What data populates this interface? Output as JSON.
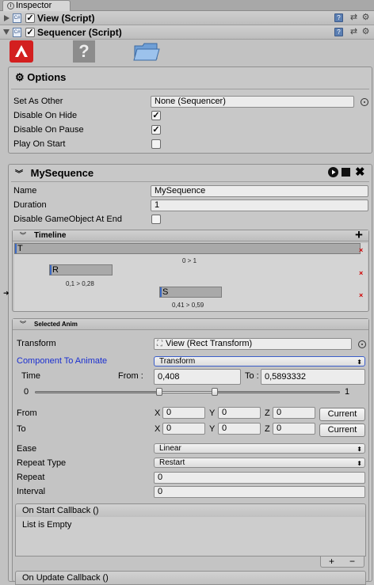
{
  "tab": {
    "title": "Inspector"
  },
  "view_component": {
    "title": "View (Script)",
    "enabled_mark": "✓"
  },
  "sequencer_component": {
    "title": "Sequencer (Script)",
    "enabled_mark": "✓"
  },
  "options": {
    "title": "Options",
    "set_as_other": {
      "label": "Set As Other",
      "value": "None (Sequencer)"
    },
    "disable_on_hide": {
      "label": "Disable On Hide",
      "checked": true,
      "mark": "✓"
    },
    "disable_on_pause": {
      "label": "Disable On Pause",
      "checked": true,
      "mark": "✓"
    },
    "play_on_start": {
      "label": "Play On Start",
      "checked": false,
      "mark": ""
    }
  },
  "sequence": {
    "title": "MySequence",
    "name": {
      "label": "Name",
      "value": "MySequence"
    },
    "duration": {
      "label": "Duration",
      "value": "1"
    },
    "disable_go": {
      "label": "Disable GameObject At End",
      "mark": ""
    }
  },
  "timeline": {
    "title": "Timeline",
    "add": "+",
    "tracks": [
      {
        "label": "T",
        "range": "0 > 1"
      },
      {
        "label": "R",
        "range": "0,1 > 0,28"
      },
      {
        "label": "S",
        "range": "0,41 > 0,59"
      }
    ],
    "delete": "×",
    "pointer": "➜"
  },
  "selected": {
    "title": "Selected Anim",
    "transform": {
      "label": "Transform",
      "value": "View (Rect Transform)"
    },
    "component": {
      "label": "Component To Animate",
      "value": "Transform"
    },
    "time": {
      "label": "Time",
      "from_label": "From :",
      "from": "0,408",
      "to_label": "To :",
      "to": "0,5893332"
    },
    "slider": {
      "min": "0",
      "max": "1",
      "from": 0.408,
      "to": 0.5893332
    },
    "from_row": {
      "label": "From",
      "x": "0",
      "y": "0",
      "z": "0",
      "button": "Current"
    },
    "to_row": {
      "label": "To",
      "x": "0",
      "y": "0",
      "z": "0",
      "button": "Current"
    },
    "axis": {
      "x": "X",
      "y": "Y",
      "z": "Z"
    },
    "ease": {
      "label": "Ease",
      "value": "Linear"
    },
    "repeat_type": {
      "label": "Repeat Type",
      "value": "Restart"
    },
    "repeat": {
      "label": "Repeat",
      "value": "0"
    },
    "interval": {
      "label": "Interval",
      "value": "0"
    },
    "on_start": {
      "title": "On Start Callback ()",
      "empty": "List is Empty",
      "plus": "+",
      "minus": "−"
    },
    "on_update": {
      "title": "On Update Callback ()"
    }
  },
  "colors": {
    "accent_blue": "#1a2fd0",
    "delete_red": "#d00000",
    "track_marker": "#3a69c5"
  }
}
